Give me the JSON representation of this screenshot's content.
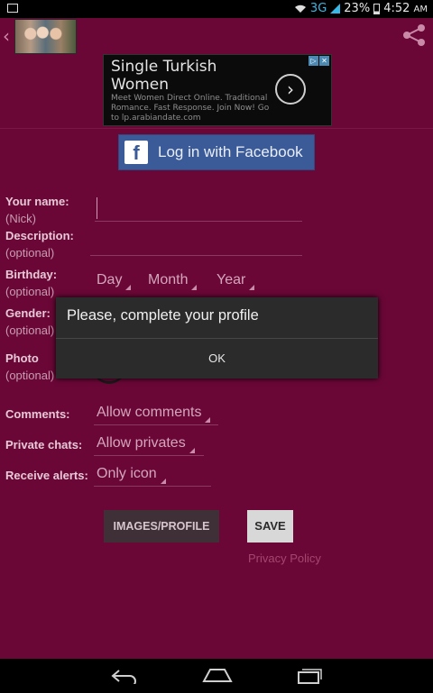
{
  "status_bar": {
    "network": "3G",
    "battery": "23%",
    "time": "4:52",
    "ampm": "AM"
  },
  "ad": {
    "title": "Single Turkish Women",
    "body": "Meet Women Direct Online. Traditional Romance. Fast Response. Join Now! Go to lp.arabiandate.com"
  },
  "facebook": {
    "label": "Log in with Facebook"
  },
  "form": {
    "name_label": "Your name:",
    "name_sub": "(Nick)",
    "desc_label": "Description:",
    "desc_sub": "(optional)",
    "birthday_label": "Birthday:",
    "birthday_sub": "(optional)",
    "day": "Day",
    "month": "Month",
    "year": "Year",
    "gender_label": "Gender:",
    "gender_sub": "(optional)",
    "photo_label": "Photo",
    "photo_sub": "(optional)",
    "comments_label": "Comments:",
    "comments_value": "Allow comments",
    "private_label": "Private chats:",
    "private_value": "Allow privates",
    "alerts_label": "Receive alerts:",
    "alerts_value": "Only icon"
  },
  "buttons": {
    "images_profile": "IMAGES/PROFILE",
    "save": "SAVE",
    "privacy": "Privacy Policy"
  },
  "dialog": {
    "message": "Please, complete your profile",
    "ok": "OK"
  },
  "icons": [
    "back-icon",
    "share-icon",
    "wifi-icon",
    "signal-icon",
    "battery-icon",
    "notification-icon",
    "facebook-icon",
    "ad-arrow-icon",
    "ad-close-icon",
    "nav-back-icon",
    "nav-home-icon",
    "nav-recents-icon"
  ]
}
